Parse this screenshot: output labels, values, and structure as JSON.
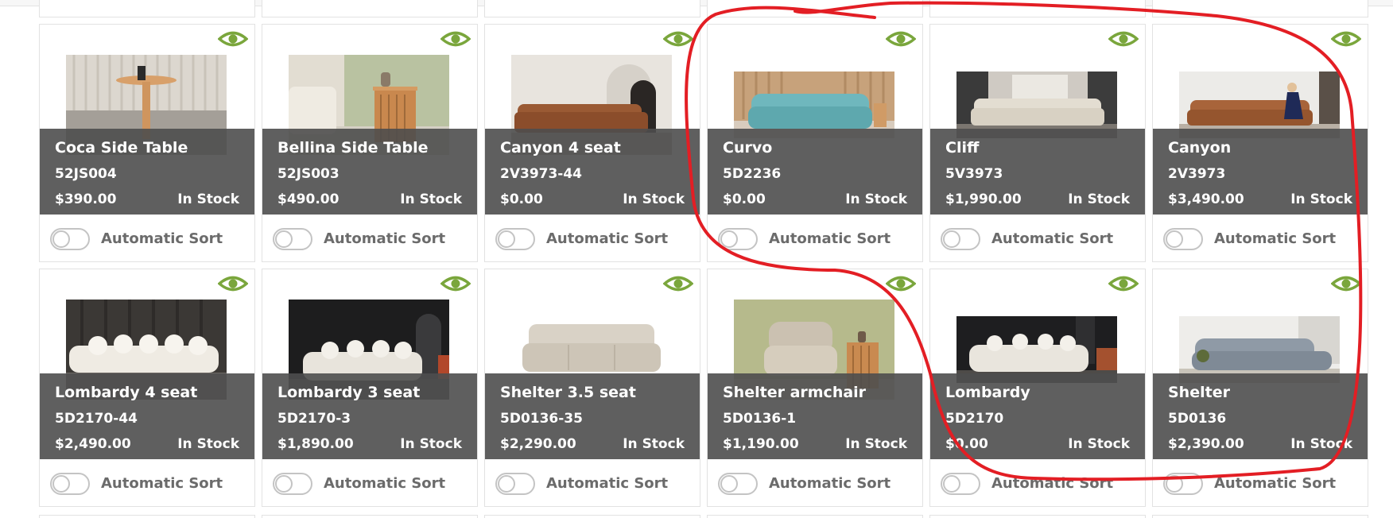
{
  "toggle_label": "Automatic Sort",
  "accent_color": "#7aa63c",
  "annotation_color": "#e31e24",
  "products": [
    {
      "name": "Coca Side Table",
      "sku": "52JS004",
      "price": "$390.00",
      "stock": "In Stock",
      "icon": "eye-icon"
    },
    {
      "name": "Bellina Side Table",
      "sku": "52JS003",
      "price": "$490.00",
      "stock": "In Stock",
      "icon": "eye-icon"
    },
    {
      "name": "Canyon 4 seat",
      "sku": "2V3973-44",
      "price": "$0.00",
      "stock": "In Stock",
      "icon": "eye-icon"
    },
    {
      "name": "Curvo",
      "sku": "5D2236",
      "price": "$0.00",
      "stock": "In Stock",
      "icon": "eye-icon"
    },
    {
      "name": "Cliff",
      "sku": "5V3973",
      "price": "$1,990.00",
      "stock": "In Stock",
      "icon": "eye-icon"
    },
    {
      "name": "Canyon",
      "sku": "2V3973",
      "price": "$3,490.00",
      "stock": "In Stock",
      "icon": "eye-icon"
    },
    {
      "name": "Lombardy 4 seat",
      "sku": "5D2170-44",
      "price": "$2,490.00",
      "stock": "In Stock",
      "icon": "eye-icon"
    },
    {
      "name": "Lombardy 3 seat",
      "sku": "5D2170-3",
      "price": "$1,890.00",
      "stock": "In Stock",
      "icon": "eye-icon"
    },
    {
      "name": "Shelter 3.5 seat",
      "sku": "5D0136-35",
      "price": "$2,290.00",
      "stock": "In Stock",
      "icon": "eye-icon"
    },
    {
      "name": "Shelter armchair",
      "sku": "5D0136-1",
      "price": "$1,190.00",
      "stock": "In Stock",
      "icon": "eye-icon"
    },
    {
      "name": "Lombardy",
      "sku": "5D2170",
      "price": "$0.00",
      "stock": "In Stock",
      "icon": "eye-icon"
    },
    {
      "name": "Shelter",
      "sku": "5D0136",
      "price": "$2,390.00",
      "stock": "In Stock",
      "icon": "eye-icon"
    }
  ]
}
